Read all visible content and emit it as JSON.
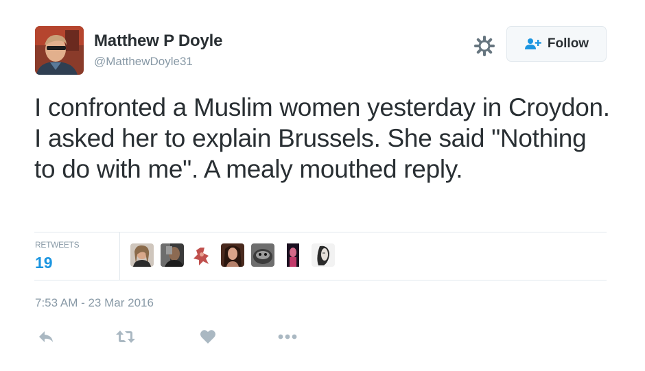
{
  "user": {
    "name": "Matthew P Doyle",
    "handle": "@MatthewDoyle31"
  },
  "follow_button": {
    "label": "Follow",
    "icon": "add-user-icon"
  },
  "settings_icon": "gear-icon",
  "tweet": {
    "text": "I confronted a Muslim women yesterday in Croydon. I asked her to explain Brussels. She said \"Nothing to do with me\". A mealy mouthed reply."
  },
  "stats": {
    "retweets_label": "RETWEETS",
    "retweets_count": "19",
    "retweeter_avatars": 7
  },
  "timestamp": "7:53 AM - 23 Mar 2016",
  "actions": [
    "reply-icon",
    "retweet-icon",
    "like-icon",
    "more-icon"
  ],
  "colors": {
    "text": "#292f33",
    "muted": "#8899a6",
    "accent": "#1b95e0",
    "border": "#e1e8ed"
  }
}
